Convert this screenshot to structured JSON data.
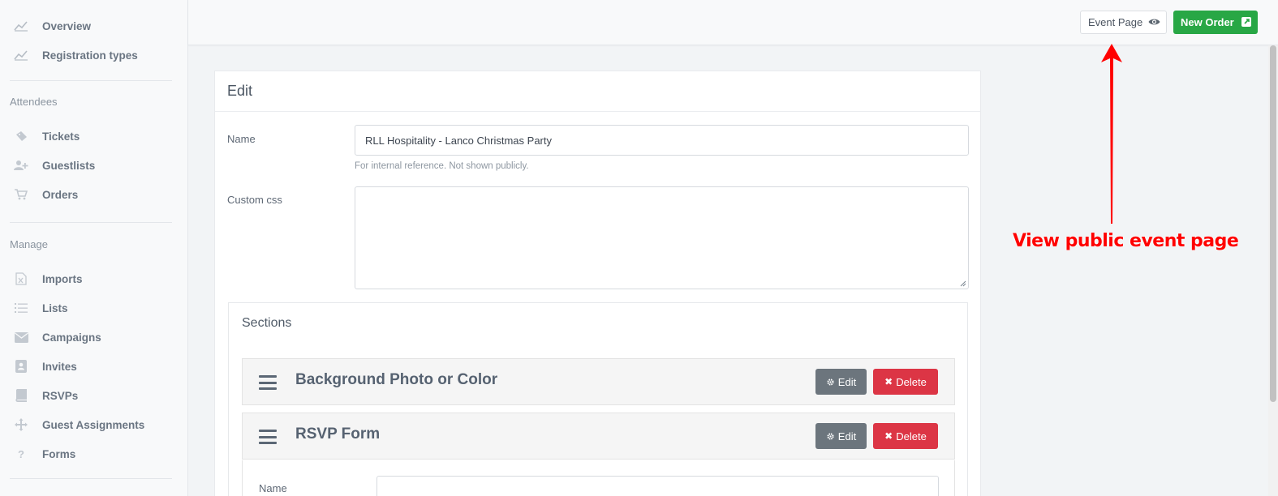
{
  "sidebar": {
    "top_items": [
      {
        "label": "Overview",
        "icon": "chart-line-icon"
      },
      {
        "label": "Registration types",
        "icon": "chart-line-icon"
      }
    ],
    "attendees_title": "Attendees",
    "attendees_items": [
      {
        "label": "Tickets",
        "icon": "ticket-icon"
      },
      {
        "label": "Guestlists",
        "icon": "user-plus-icon"
      },
      {
        "label": "Orders",
        "icon": "cart-icon"
      }
    ],
    "manage_title": "Manage",
    "manage_items": [
      {
        "label": "Imports",
        "icon": "excel-file-icon"
      },
      {
        "label": "Lists",
        "icon": "list-icon"
      },
      {
        "label": "Campaigns",
        "icon": "envelope-icon"
      },
      {
        "label": "Invites",
        "icon": "address-book-icon"
      },
      {
        "label": "RSVPs",
        "icon": "book-icon"
      },
      {
        "label": "Guest Assignments",
        "icon": "arrows-icon"
      },
      {
        "label": "Forms",
        "icon": "question-icon"
      }
    ]
  },
  "topbar": {
    "event_page_label": "Event Page",
    "new_order_label": "New Order",
    "accent_green": "#28a745"
  },
  "card": {
    "title": "Edit",
    "name_label": "Name",
    "name_value": "RLL Hospitality - Lanco Christmas Party",
    "name_help": "For internal reference. Not shown publicly.",
    "custom_css_label": "Custom css",
    "custom_css_value": "",
    "sections_title": "Sections",
    "sections": [
      {
        "title": "Background Photo or Color",
        "edit_label": "Edit",
        "delete_label": "Delete"
      },
      {
        "title": "RSVP Form",
        "edit_label": "Edit",
        "delete_label": "Delete"
      }
    ],
    "rsvp_name_label": "Name"
  },
  "annotation": {
    "text": "View public event page",
    "color": "#ff0000"
  }
}
